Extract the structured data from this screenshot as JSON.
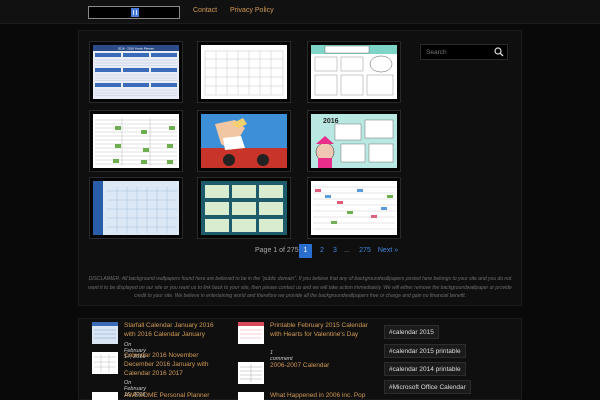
{
  "nav": {
    "links": [
      "Contact",
      "Privacy Policy"
    ]
  },
  "gallery": {
    "thumbs": [
      {
        "name": "thumb-yearly-planner",
        "caption": "2016 - 2016 Yearly Planner"
      },
      {
        "name": "thumb-blank-calendar"
      },
      {
        "name": "thumb-kids-planner"
      },
      {
        "name": "thumb-green-calendar"
      },
      {
        "name": "thumb-pinup-photo"
      },
      {
        "name": "thumb-2016-cartoon",
        "caption": "2016"
      },
      {
        "name": "thumb-blue-calendar"
      },
      {
        "name": "thumb-teal-calendar"
      },
      {
        "name": "thumb-colorful-calendar"
      }
    ]
  },
  "pagination": {
    "label": "Page 1 of 275",
    "pages": [
      "1",
      "2",
      "3",
      "...",
      "275"
    ],
    "next": "Next »"
  },
  "disclaimer": "DISCLAIMER: All background wallpapers found here are believed to be in the \"public domain\". If you believe that any of backgroundwallpapers posted here belongs to your site and you do not want it to be displayed on our site or you want us to link back to your site, then please contact us and we will take action immediately. We will either remove the backgroundwallpaper or provide credit to your site. We believe in entertaining world and therefore we provide all the backgroundwallpapers free or charge and gain no financial benefit.",
  "search": {
    "placeholder": "Search"
  },
  "posts_left": [
    {
      "title": "Starfall Calendar January 2016 with 2016 Calendar January",
      "meta": "On February 17, 2016"
    },
    {
      "title": "Calendar 2016 November December 2016 January with Calendar 2016 2017",
      "meta": "On February 16, 2016"
    },
    {
      "title": "AWESOME Personal Planner",
      "meta": ""
    }
  ],
  "posts_mid": [
    {
      "title": "Printable February 2015 Calendar with Hearts for Valentine's Day",
      "meta": "1 comment"
    },
    {
      "title": "2006-2007 Calendar",
      "meta": ""
    },
    {
      "title": "What Happened in 2006 inc. Pop",
      "meta": ""
    }
  ],
  "tags": [
    "#calendar 2015",
    "#calendar 2015 printable",
    "#calendar 2014 printable",
    "#Microsoft Office Calendar"
  ],
  "colors": {
    "accent": "#d29a55",
    "link": "#3d86e0",
    "page_active": "#2a6fd0"
  }
}
